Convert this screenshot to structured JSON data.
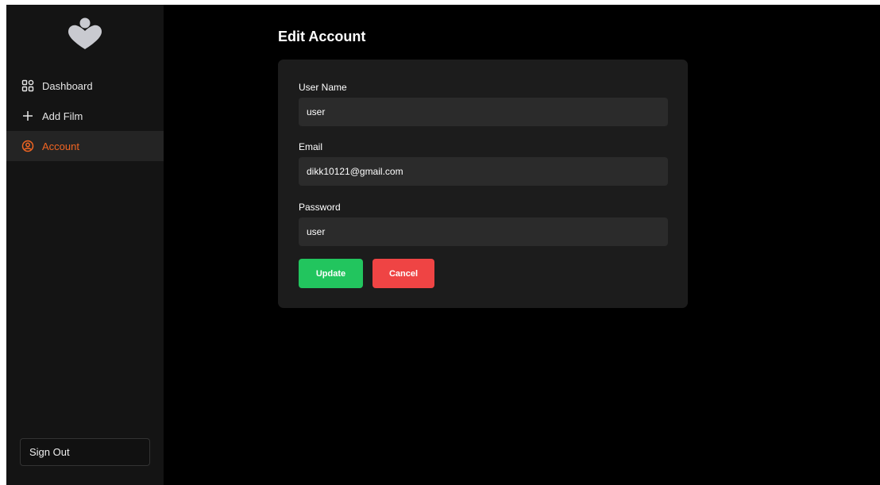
{
  "sidebar": {
    "logo_icon": "heart-person-icon",
    "items": [
      {
        "label": "Dashboard",
        "icon": "grid-icon",
        "active": false
      },
      {
        "label": "Add Film",
        "icon": "plus-icon",
        "active": false
      },
      {
        "label": "Account",
        "icon": "user-circle-icon",
        "active": true
      }
    ],
    "signout_label": "Sign Out"
  },
  "page": {
    "title": "Edit Account"
  },
  "form": {
    "username": {
      "label": "User Name",
      "value": "user"
    },
    "email": {
      "label": "Email",
      "value": "dikk10121@gmail.com"
    },
    "password": {
      "label": "Password",
      "value": "user"
    }
  },
  "buttons": {
    "update_label": "Update",
    "cancel_label": "Cancel"
  },
  "colors": {
    "accent": "#f26522",
    "update": "#22c55e",
    "cancel": "#ef4444",
    "logo": "#c9cad0"
  }
}
